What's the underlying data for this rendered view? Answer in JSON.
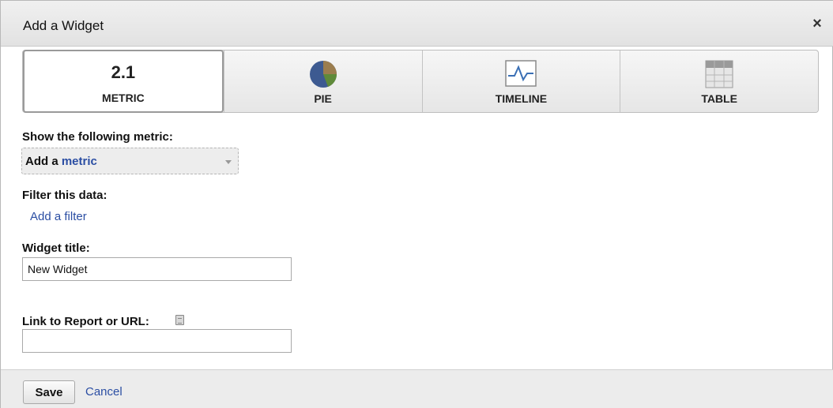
{
  "dialog": {
    "title": "Add a Widget",
    "close_symbol": "×"
  },
  "tabs": [
    {
      "label": "METRIC",
      "value": "2.1",
      "icon": "metric-value",
      "selected": true
    },
    {
      "label": "PIE",
      "icon": "pie-chart-icon",
      "selected": false
    },
    {
      "label": "TIMELINE",
      "icon": "timeline-chart-icon",
      "selected": false
    },
    {
      "label": "TABLE",
      "icon": "table-grid-icon",
      "selected": false
    }
  ],
  "form": {
    "metric_label": "Show the following metric:",
    "metric_select_prefix": "Add a",
    "metric_select_link": "metric",
    "filter_label": "Filter this data:",
    "filter_link": "Add a filter",
    "widget_title_label": "Widget title:",
    "widget_title_value": "New Widget",
    "link_label": "Link to Report or URL:",
    "link_value": ""
  },
  "footer": {
    "save_label": "Save",
    "cancel_label": "Cancel"
  },
  "colors": {
    "link": "#2b4ea3",
    "pie_blue": "#3d5a91",
    "pie_green": "#5f8a3a",
    "pie_brown": "#9b7d4e",
    "timeline_line": "#3a6fb5"
  }
}
